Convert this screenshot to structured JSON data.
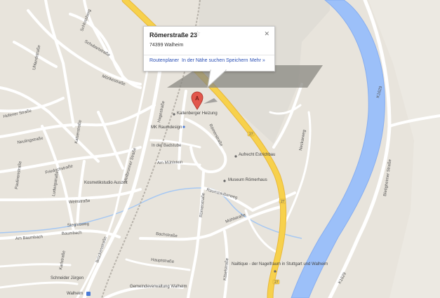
{
  "popup": {
    "title": "Römerstraße 23",
    "star": "☆",
    "close": "✕",
    "address": "74399 Walheim",
    "actions": {
      "route": "Routenplaner",
      "nearby": "In der Nähe suchen",
      "save": "Speichern",
      "more": "Mehr »"
    }
  },
  "marker": {
    "letter": "A"
  },
  "colors": {
    "river": "#9cc0f9",
    "highway": "#f7d14c",
    "land": "#e8e4dc",
    "road": "#ffffff"
  },
  "labels": {
    "hofener": "Hofener Straße",
    "neuling": "Neulingstraße",
    "friedrich": "Friedrichstraße",
    "paulinen": "Paulinenstraße",
    "ludwig": "Ludwigstraße",
    "kaiser": "Kaiserstraße",
    "weinstr": "Weinstraße",
    "stegles": "Steglesweg",
    "baumbach": "Baumbach",
    "am_baumbach": "Am Baumbach",
    "schlossberg": "Schlossberg",
    "schubart": "Schubartstraße",
    "uhland": "Uhlandstraße",
    "moerike": "Mörikestraße",
    "heilbronner": "Heilbronner Straße",
    "hagestr": "Hagestraße",
    "badstube": "In der Badstube",
    "muehlstein": "Am Mühlstein",
    "roemerstr": "Römerstraße",
    "raumzauber": "Raumzauberweg",
    "muehlstr": "Mühlstraße",
    "bachstr": "Bachstraße",
    "hauptstr": "Hauptstraße",
    "kaeselstr": "Käselstraße",
    "bruckenstr": "Brückenstraße",
    "karlstr": "Karlstraße",
    "neckarweg": "Neckarweg",
    "bietigheimer": "Bietigheimer Straße",
    "k1629": "K1629",
    "road27": "27",
    "poi_kallenberger": "Kallenberger Heizung",
    "poi_mk": "MK Raumdesign",
    "poi_aufrecht": "Aufrecht Estrichbau",
    "poi_museum": "Museum Römerhaus",
    "poi_kosmetik": "Kosmetikstudio Auszeit",
    "poi_nailtique": "Nailtique - der Nagelfraum in Stuttgart und Walheim",
    "poi_gemeinde": "Gemeindeverwaltung Walheim",
    "poi_schneider": "Schneider Jürgen",
    "walheim": "Walheim"
  }
}
